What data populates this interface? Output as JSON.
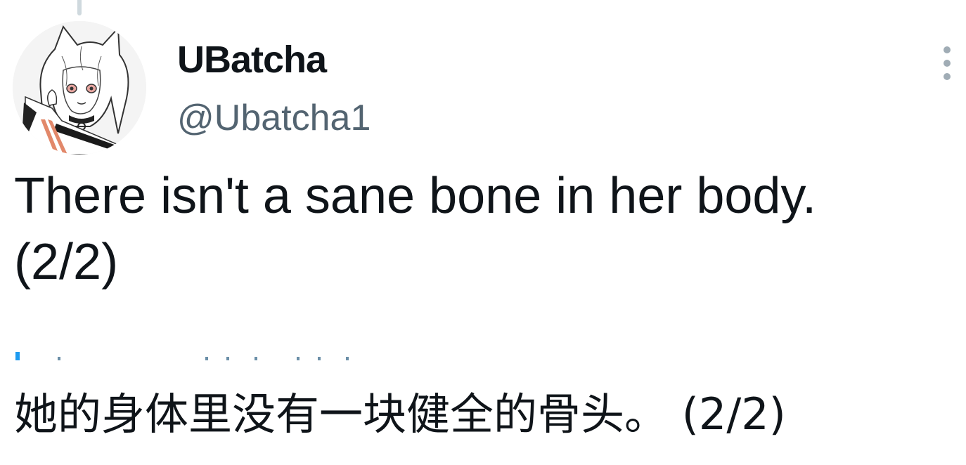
{
  "tweet": {
    "author": {
      "display_name": "UBatcha",
      "handle": "@Ubatcha1",
      "avatar_icon": "anime-character-avatar"
    },
    "text": "There isn't a sane bone in her body.\n(2/2)",
    "translated_text": "她的身体里没有一块健全的骨头。 (2/2)",
    "more_icon": "vertical-ellipsis-icon"
  },
  "colors": {
    "text_primary": "#0f1419",
    "text_secondary": "#536471",
    "thread_line": "#cfd9de",
    "more_dots": "#a0acb5",
    "accent": "#1d9bf0"
  }
}
